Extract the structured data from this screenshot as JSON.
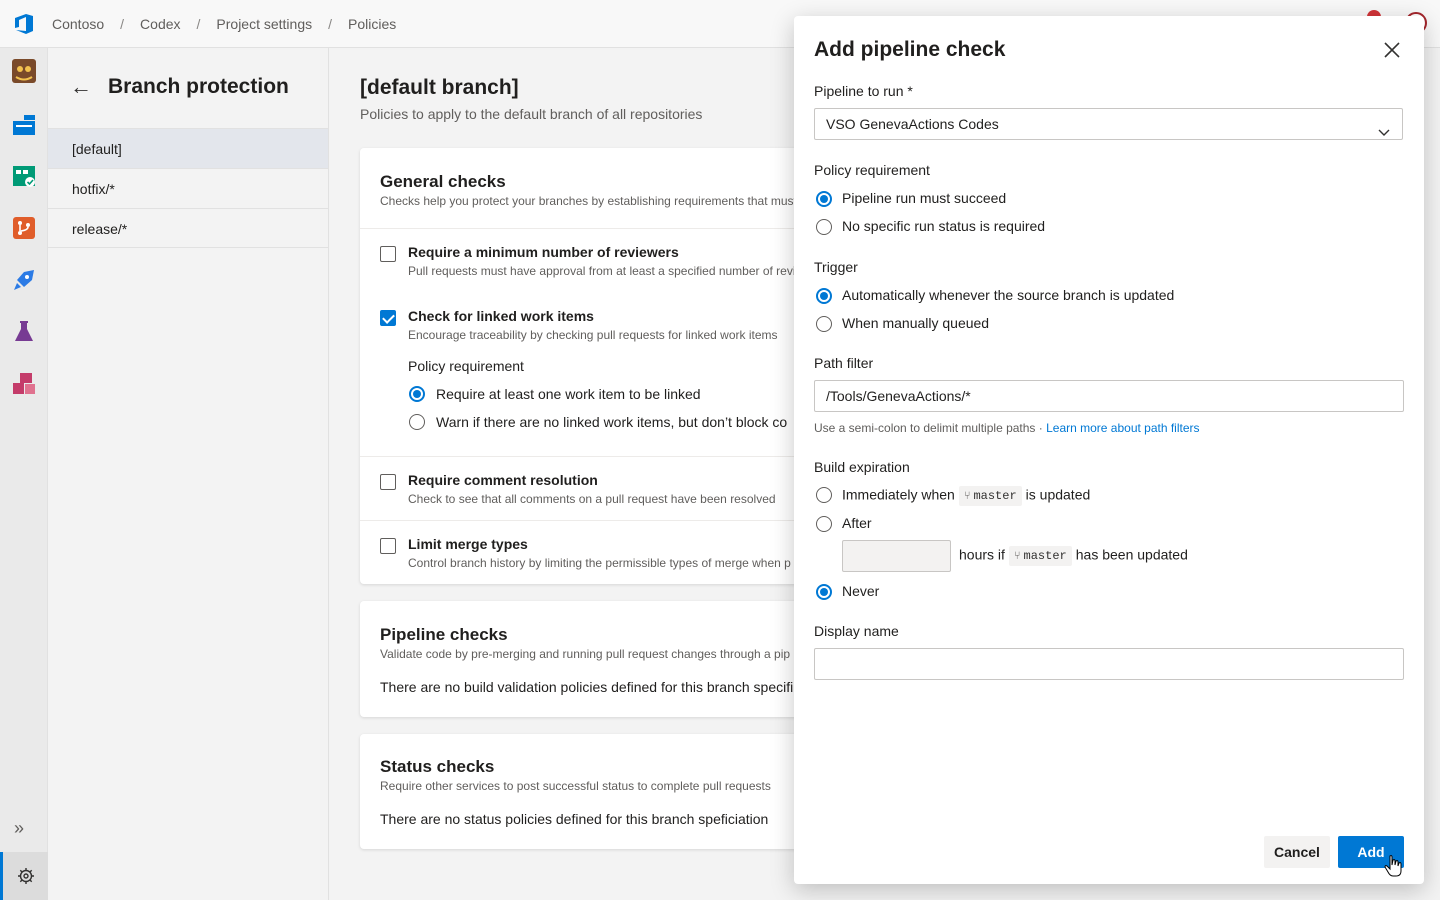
{
  "breadcrumb": [
    "Contoso",
    "Codex",
    "Project settings",
    "Policies"
  ],
  "subnav": {
    "title": "Branch protection",
    "items": [
      "[default]",
      "hotfix/*",
      "release/*"
    ]
  },
  "main": {
    "title": "[default branch]",
    "subtitle": "Policies to apply to the default branch of all repositories",
    "general": {
      "title": "General checks",
      "desc": "Checks help you protect your branches by establishing requirements that must",
      "reviewers": {
        "label": "Require a minimum number of reviewers",
        "desc": "Pull requests must have approval from at least a specified number of revi"
      },
      "workitems": {
        "label": "Check for linked work items",
        "desc": "Encourage traceability by checking pull requests for linked work items",
        "req_label": "Policy requirement",
        "opt1": "Require at least one work item to be linked",
        "opt2": "Warn if there are no linked work items, but don’t block co"
      },
      "comments": {
        "label": "Require comment resolution",
        "desc": "Check to see that all comments on a pull request have been resolved"
      },
      "merge": {
        "label": "Limit merge types",
        "desc": "Control branch history by limiting the permissible types of merge when p"
      }
    },
    "pipeline": {
      "title": "Pipeline checks",
      "desc": "Validate code by pre-merging and running pull request changes through a pip",
      "empty": "There are no build validation policies defined for this branch specifi"
    },
    "status": {
      "title": "Status checks",
      "desc": "Require other services to post successful status to complete pull requests",
      "empty": "There are no status policies defined for this branch speficiation"
    }
  },
  "dialog": {
    "title": "Add pipeline check",
    "pipeline_label": "Pipeline to run *",
    "pipeline_value": "VSO GenevaActions Codes",
    "policy_label": "Policy requirement",
    "policy_opt1": "Pipeline run must succeed",
    "policy_opt2": "No specific run status is required",
    "trigger_label": "Trigger",
    "trigger_opt1": "Automatically whenever the source branch is updated",
    "trigger_opt2": "When manually queued",
    "path_label": "Path filter",
    "path_value": "/Tools/GenevaActions/*",
    "path_help": "Use a semi-colon to delimit multiple paths · ",
    "path_help_link": "Learn more about path filters",
    "expiration_label": "Build expiration",
    "exp_opt1_pre": "Immediately when",
    "exp_opt1_post": "is updated",
    "branch": "master",
    "exp_opt2": "After",
    "hours_pre": "hours if",
    "hours_post": "has been updated",
    "exp_opt3": "Never",
    "display_label": "Display name",
    "display_value": "",
    "cancel": "Cancel",
    "add": "Add"
  },
  "colors": {
    "accent": "#0078d4",
    "rail_bg": "#eaeaea",
    "notif": "#d13438"
  }
}
